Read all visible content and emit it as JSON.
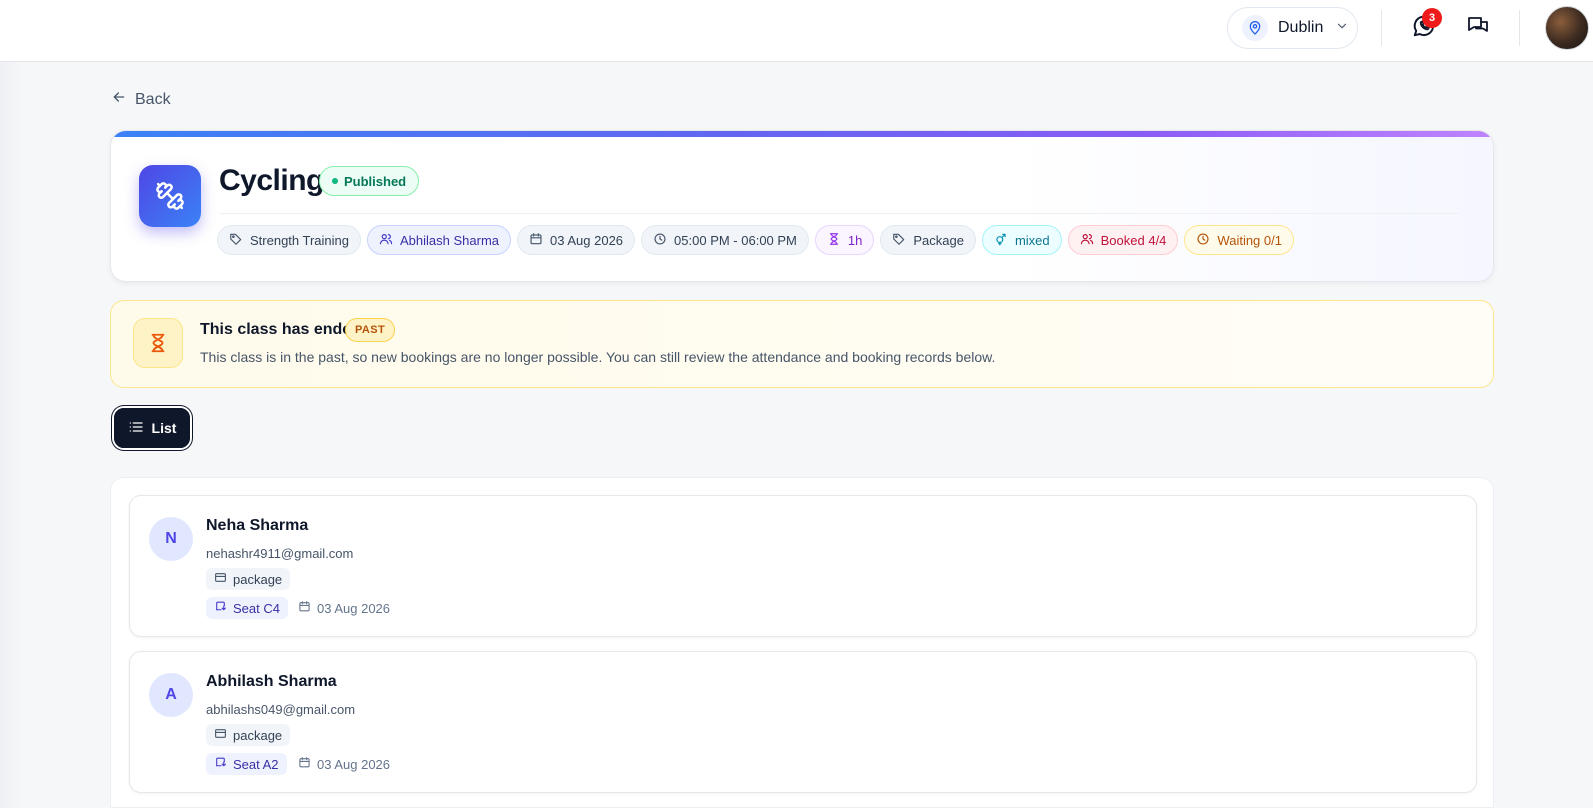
{
  "header": {
    "location": "Dublin",
    "notification_count": "3"
  },
  "nav": {
    "back_label": "Back"
  },
  "class": {
    "title": "Cycling",
    "status": "Published",
    "chips": {
      "category": "Strength Training",
      "instructor": "Abhilash Sharma",
      "date": "03 Aug 2026",
      "time": "05:00 PM - 06:00 PM",
      "duration": "1h",
      "type": "Package",
      "gender": "mixed",
      "booked": "Booked 4/4",
      "waiting": "Waiting 0/1"
    }
  },
  "notice": {
    "title": "This class has ended",
    "badge": "PAST",
    "description": "This class is in the past, so new bookings are no longer possible. You can still review the attendance and booking records below."
  },
  "view_toggle": {
    "list_label": "List"
  },
  "bookings": [
    {
      "initial": "N",
      "name": "Neha Sharma",
      "email": "nehashr4911@gmail.com",
      "plan": "package",
      "seat": "Seat C4",
      "date": "03 Aug 2026"
    },
    {
      "initial": "A",
      "name": "Abhilash Sharma",
      "email": "abhilashs049@gmail.com",
      "plan": "package",
      "seat": "Seat A2",
      "date": "03 Aug 2026"
    }
  ],
  "colors": {
    "accent": "#4f46e5",
    "published": "#10b981",
    "past": "#b45309",
    "badge": "#ef1b1b"
  }
}
